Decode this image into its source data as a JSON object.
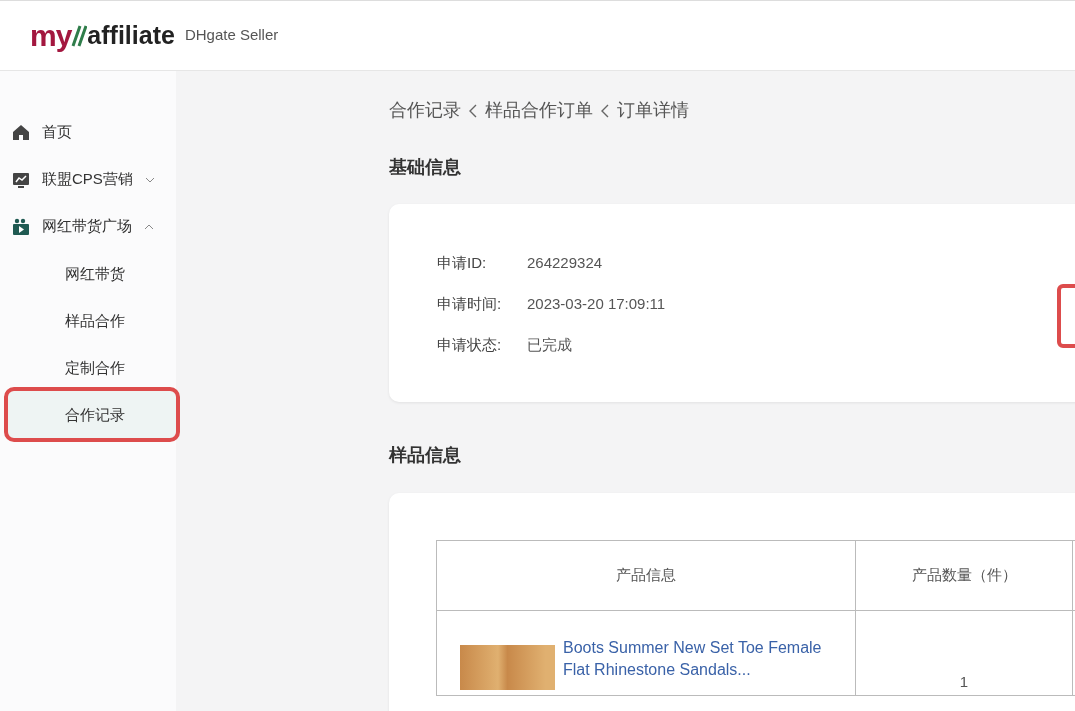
{
  "header": {
    "logo_brand": "my",
    "logo_word": "affiliate",
    "subtitle": "DHgate Seller"
  },
  "sidebar": {
    "items": [
      {
        "label": "首页"
      },
      {
        "label": "联盟CPS营销",
        "expanded": false
      },
      {
        "label": "网红带货广场",
        "expanded": true,
        "children": [
          {
            "label": "网红带货",
            "selected": false,
            "highlighted": false
          },
          {
            "label": "样品合作",
            "selected": false,
            "highlighted": false
          },
          {
            "label": "定制合作",
            "selected": false,
            "highlighted": false
          },
          {
            "label": "合作记录",
            "selected": true,
            "highlighted": true
          }
        ]
      }
    ]
  },
  "breadcrumb": [
    "合作记录",
    "样品合作订单",
    "订单详情"
  ],
  "basic_info": {
    "title": "基础信息",
    "highlighted": true,
    "fields": [
      {
        "label": "申请ID:",
        "value": "264229324"
      },
      {
        "label": "申请时间:",
        "value": "2023-03-20 17:09:11"
      },
      {
        "label": "申请状态:",
        "value": "已完成"
      }
    ]
  },
  "sample_info": {
    "title": "样品信息",
    "table": {
      "columns": [
        "产品信息",
        "产品数量（件）"
      ],
      "rows": [
        {
          "product": "Boots Summer New Set Toe Female Flat Rhinestone Sandals...",
          "quantity": "1"
        }
      ]
    }
  }
}
